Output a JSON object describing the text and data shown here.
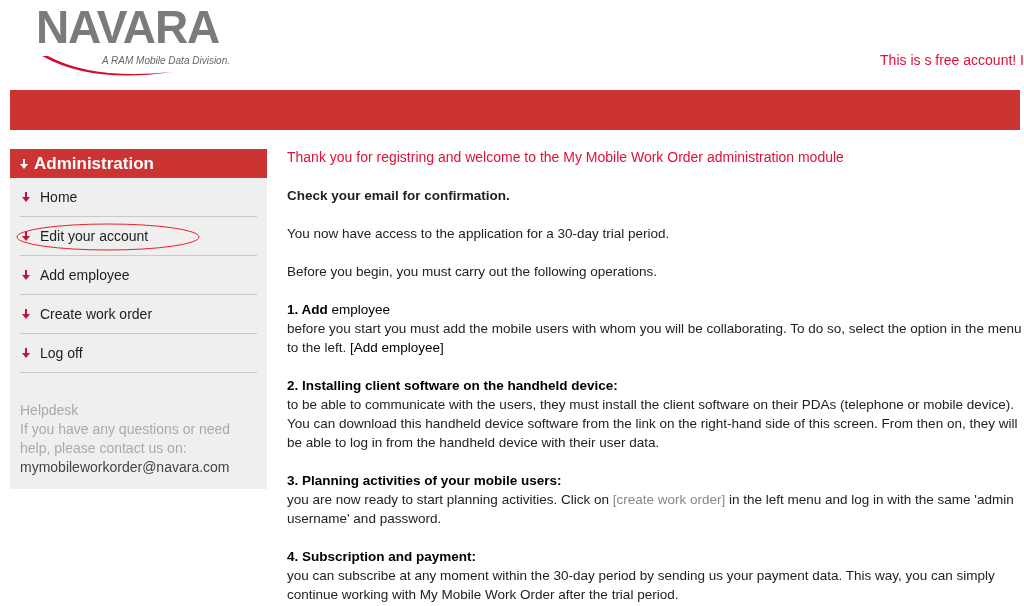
{
  "logo": {
    "name": "NAVARA",
    "tagline": "A RAM Mobile Data Division."
  },
  "notice": "This is s free account! I",
  "sidebar": {
    "title": "Administration",
    "items": [
      {
        "label": "Home",
        "circled": false
      },
      {
        "label": "Edit your account",
        "circled": true
      },
      {
        "label": "Add employee",
        "circled": false
      },
      {
        "label": "Create work order",
        "circled": false
      },
      {
        "label": "Log off",
        "circled": false
      }
    ],
    "helpdesk": {
      "title": "Helpdesk",
      "text": "If you have any questions or need help, please contact us on:",
      "email": "mymobileworkorder@navara.com"
    }
  },
  "content": {
    "welcome": "Thank you for registring and welcome to the My Mobile Work Order administration module",
    "confirmation": "Check your email for confirmation.",
    "intro": [
      "You now have access to the application for a 30-day trial period.",
      "Before you begin, you must carry out the following operations."
    ],
    "steps": [
      {
        "heading": "**1. Add** employee",
        "body": [
          {
            "kind": "plain",
            "text": "before you start you must add the mobile users with whom you will be collaborating. To do so, select the option in the menu to the left. "
          },
          {
            "kind": "bracket",
            "text": "[Add employee]"
          }
        ]
      },
      {
        "heading": "**2. Installing client software on the handheld device:**",
        "body": [
          {
            "kind": "plain",
            "text": "to be able to communicate with the users, they must install the client software on their PDAs (telephone or mobile device). You can download this handheld device software from the link on the right-hand side of this screen. From then on, they will be able to log in from the handheld device with their user data."
          }
        ]
      },
      {
        "heading": "**3. Planning activities of your mobile users:**",
        "body": [
          {
            "kind": "plain",
            "text": "you are now ready to start planning activities. Click on "
          },
          {
            "kind": "link",
            "text": "[create work order]"
          },
          {
            "kind": "plain",
            "text": " in the left menu and log in with the same 'admin username' and password."
          }
        ]
      },
      {
        "heading": "**4. Subscription and payment:**",
        "body": [
          {
            "kind": "plain",
            "text": "you can subscribe at any moment within the 30-day period by sending us your payment data. This way, you can simply continue working with My Mobile Work Order after the trial period."
          }
        ]
      }
    ]
  }
}
